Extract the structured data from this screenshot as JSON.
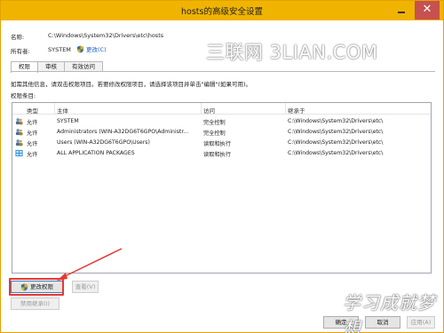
{
  "window": {
    "title": "hosts的高级安全设置",
    "minimize_label": "",
    "close_label": "✕"
  },
  "file": {
    "name_label": "名称:",
    "name_value": "C:\\Windows\\System32\\Drivers\\etc\\hosts",
    "owner_label": "所有者:",
    "owner_value": "SYSTEM",
    "change_link": "更改(C)"
  },
  "tabs": [
    {
      "label": "权限",
      "active": true
    },
    {
      "label": "审核",
      "active": false
    },
    {
      "label": "有效访问",
      "active": false
    }
  ],
  "hint": "如需其他信息，请双击权限项目。若要修改权限项目，请选择该项目并单击\"编辑\"(如果可用)。",
  "entries_label": "权限条目:",
  "table": {
    "columns": [
      "类型",
      "主体",
      "访问",
      "继承于"
    ],
    "rows": [
      {
        "icon": "users-icon",
        "type": "允许",
        "principal": "SYSTEM",
        "access": "完全控制",
        "inherited": "C:\\Windows\\System32\\Drivers\\etc\\"
      },
      {
        "icon": "users-icon",
        "type": "允许",
        "principal": "Administrators (WIN-A32DG6T6GPO\\Administr...",
        "access": "完全控制",
        "inherited": "C:\\Windows\\System32\\Drivers\\etc\\"
      },
      {
        "icon": "users-icon",
        "type": "允许",
        "principal": "Users (WIN-A32DG6T6GPO\\Users)",
        "access": "读取和执行",
        "inherited": "C:\\Windows\\System32\\Drivers\\etc\\"
      },
      {
        "icon": "app-packages-icon",
        "type": "允许",
        "principal": "ALL APPLICATION PACKAGES",
        "access": "读取和执行",
        "inherited": "C:\\Windows\\System32\\Drivers\\etc\\"
      }
    ]
  },
  "buttons": {
    "change_permissions": "更改权限",
    "view": "查看(V)",
    "disable_inheritance": "禁用继承(I)",
    "ok": "确定",
    "cancel": "取消",
    "apply": "应用(A)"
  },
  "watermarks": {
    "top": "三联网 3LIAN.COM",
    "bottom": "学习成就梦想"
  },
  "colors": {
    "titlebar": "#f0b400",
    "close_button": "#c75050",
    "highlight_box": "#e53935",
    "link": "#1a5fbf"
  }
}
